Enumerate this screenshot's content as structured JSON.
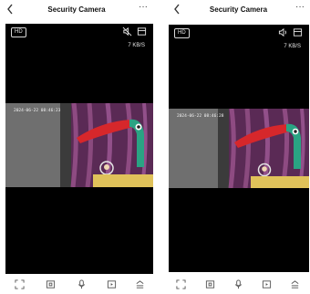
{
  "screens": [
    {
      "title": "Security Camera",
      "back_icon": "chevron-left-icon",
      "more_label": "···",
      "quality_badge": "HD",
      "audio_state": "muted",
      "data_rate": "7 KB/S",
      "timestamp": "2024-06-22 08:46:23"
    },
    {
      "title": "Security Camera",
      "back_icon": "chevron-left-icon",
      "more_label": "···",
      "quality_badge": "HD",
      "audio_state": "unmuted",
      "data_rate": "7 KB/S",
      "timestamp": "2024-06-22 08:46:28"
    }
  ],
  "bottom_toolbar": [
    "fullscreen-icon",
    "snapshot-icon",
    "microphone-icon",
    "record-icon",
    "menu-up-icon"
  ],
  "colors": {
    "background": "#000000",
    "beak_red": "#d6272b",
    "curtain_purple": "#7b3a6c",
    "wall_gray": "#6b6b6b"
  }
}
